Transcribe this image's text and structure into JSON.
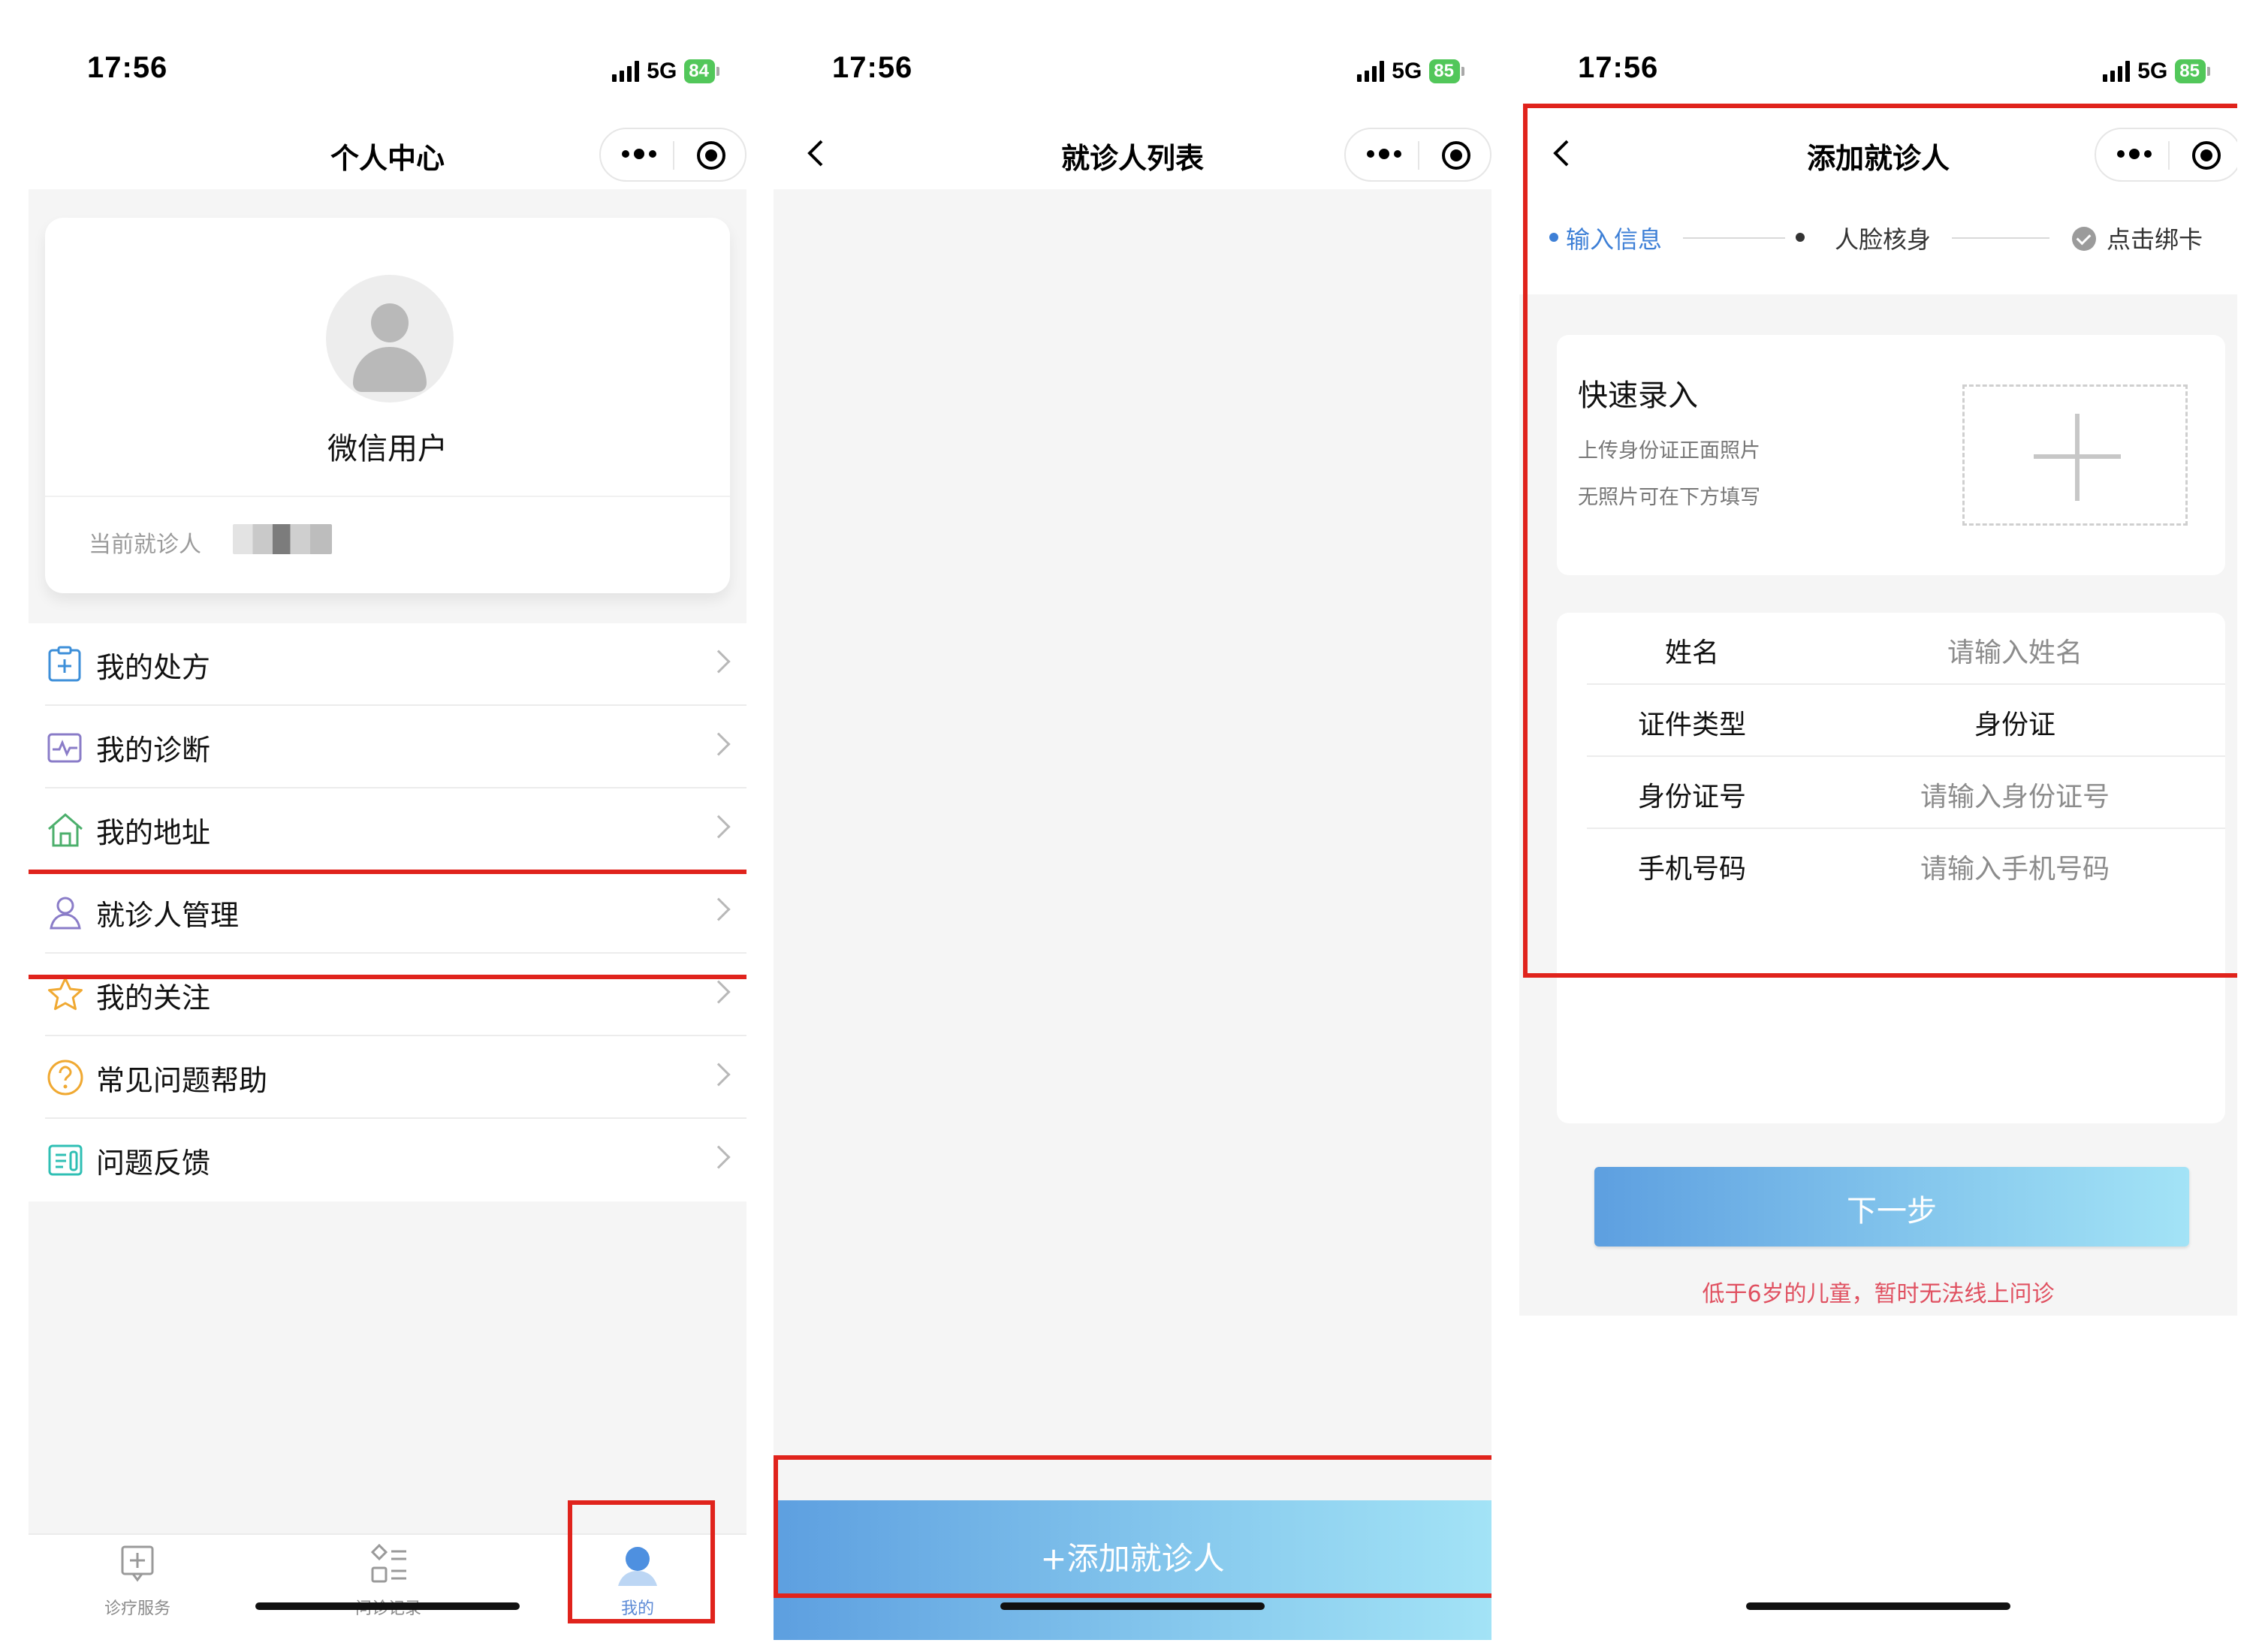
{
  "status_bar": {
    "time": "17:56",
    "network": "5G"
  },
  "screens": [
    {
      "battery": "84",
      "title": "个人中心",
      "profile": {
        "username": "微信用户",
        "current_patient_label": "当前就诊人"
      },
      "menu": [
        {
          "label": "我的处方",
          "icon": "prescription-icon"
        },
        {
          "label": "我的诊断",
          "icon": "diagnosis-icon"
        },
        {
          "label": "我的地址",
          "icon": "house-icon"
        },
        {
          "label": "就诊人管理",
          "icon": "patient-manage-icon"
        },
        {
          "label": "我的关注",
          "icon": "star-icon"
        },
        {
          "label": "常见问题帮助",
          "icon": "question-icon"
        },
        {
          "label": "问题反馈",
          "icon": "feedback-icon"
        }
      ],
      "tabs": [
        {
          "label": "诊疗服务",
          "icon": "medical-plus-icon"
        },
        {
          "label": "问诊记录",
          "icon": "records-icon"
        },
        {
          "label": "我的",
          "icon": "user-icon",
          "active": true
        }
      ]
    },
    {
      "battery": "85",
      "title": "就诊人列表",
      "add_button": "+添加就诊人"
    },
    {
      "battery": "85",
      "title": "添加就诊人",
      "steps": [
        {
          "label": "输入信息",
          "state": "active"
        },
        {
          "label": "人脸核身",
          "state": "pending"
        },
        {
          "label": "点击绑卡",
          "state": "pending"
        }
      ],
      "quick_entry": {
        "title": "快速录入",
        "line1": "上传身份证正面照片",
        "line2": "无照片可在下方填写"
      },
      "form": [
        {
          "label": "姓名",
          "placeholder": "请输入姓名"
        },
        {
          "label": "证件类型",
          "value": "身份证"
        },
        {
          "label": "身份证号",
          "placeholder": "请输入身份证号"
        },
        {
          "label": "手机号码",
          "placeholder": "请输入手机号码"
        }
      ],
      "next_button": "下一步",
      "warning": "低于6岁的儿童，暂时无法线上问诊"
    }
  ],
  "colors": {
    "highlight": "#e0231c",
    "accent": "#3d7fd6",
    "warning": "#e05060",
    "battery": "#52c75a"
  }
}
